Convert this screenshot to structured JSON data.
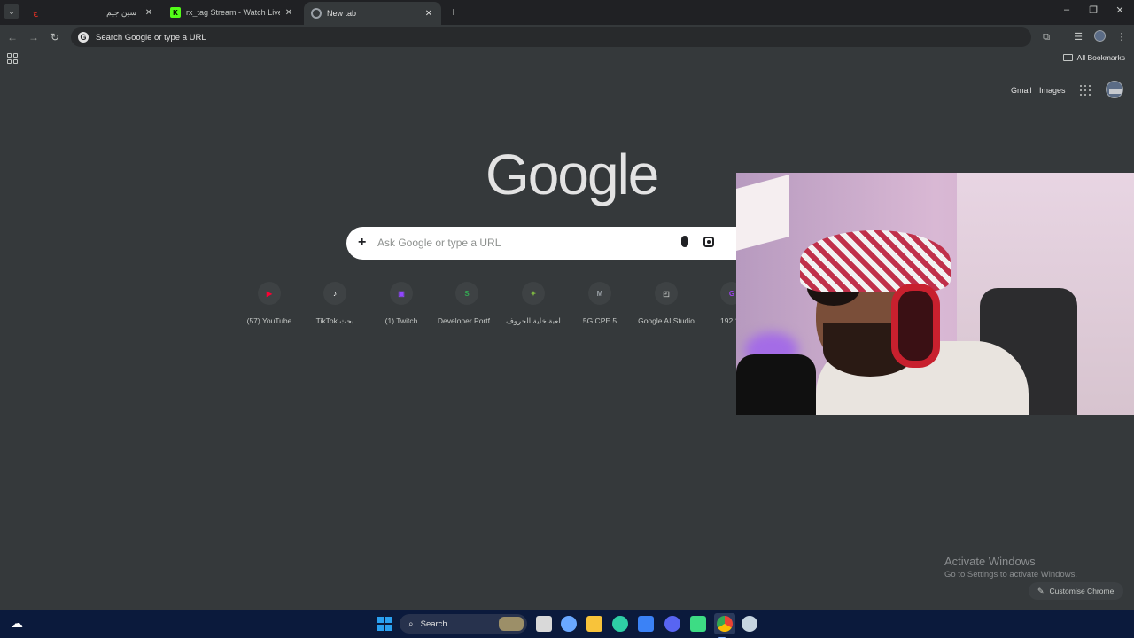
{
  "tabs": [
    {
      "title": "سين جيم",
      "favicon_color": "#d93025",
      "favicon_text": "ج"
    },
    {
      "title": "rx_tag Stream - Watch Live on K",
      "favicon_color": "#53fc18",
      "favicon_text": "K"
    },
    {
      "title": "New tab",
      "favicon_color": "#9aa0a6",
      "favicon_text": ""
    }
  ],
  "omnibox": {
    "text": "Search Google or type a URL"
  },
  "bookmarks": {
    "all_label": "All Bookmarks"
  },
  "ntp": {
    "gmail": "Gmail",
    "images": "Images",
    "logo": "Google",
    "search_placeholder": "Ask Google or type a URL",
    "shortcuts": [
      {
        "label": "(57) YouTube",
        "icon_color": "#ff0033",
        "icon_text": "▶"
      },
      {
        "label": "TikTok بحث",
        "icon_color": "#ffffff",
        "icon_text": "♪"
      },
      {
        "label": "(1) Twitch",
        "icon_color": "#9146ff",
        "icon_text": "▣"
      },
      {
        "label": "Developer Portf...",
        "icon_color": "#34a853",
        "icon_text": "S"
      },
      {
        "label": "لعبة خلية الحروف",
        "icon_color": "#7cb342",
        "icon_text": "✦"
      },
      {
        "label": "5G CPE 5",
        "icon_color": "#9aa0a6",
        "icon_text": "M"
      },
      {
        "label": "Google AI Studio",
        "icon_color": "#c4c7c5",
        "icon_text": "◰"
      },
      {
        "label": "192.16",
        "icon_color": "#a142f4",
        "icon_text": "G"
      }
    ],
    "customise": "Customise Chrome"
  },
  "watermark": {
    "title": "Activate Windows",
    "subtitle": "Go to Settings to activate Windows."
  },
  "taskbar": {
    "search": "Search",
    "apps": [
      {
        "name": "task-view",
        "color": "#d9d9d9"
      },
      {
        "name": "copilot",
        "color": "#6aa8ff"
      },
      {
        "name": "file-explorer",
        "color": "#f8c33a"
      },
      {
        "name": "edge",
        "color": "#2ecfa5"
      },
      {
        "name": "store",
        "color": "#3b82f6"
      },
      {
        "name": "discord",
        "color": "#5865f2"
      },
      {
        "name": "app-green",
        "color": "#3ddc84"
      },
      {
        "name": "chrome",
        "color": "#ea4335"
      },
      {
        "name": "steam",
        "color": "#c7d5e0"
      }
    ]
  }
}
